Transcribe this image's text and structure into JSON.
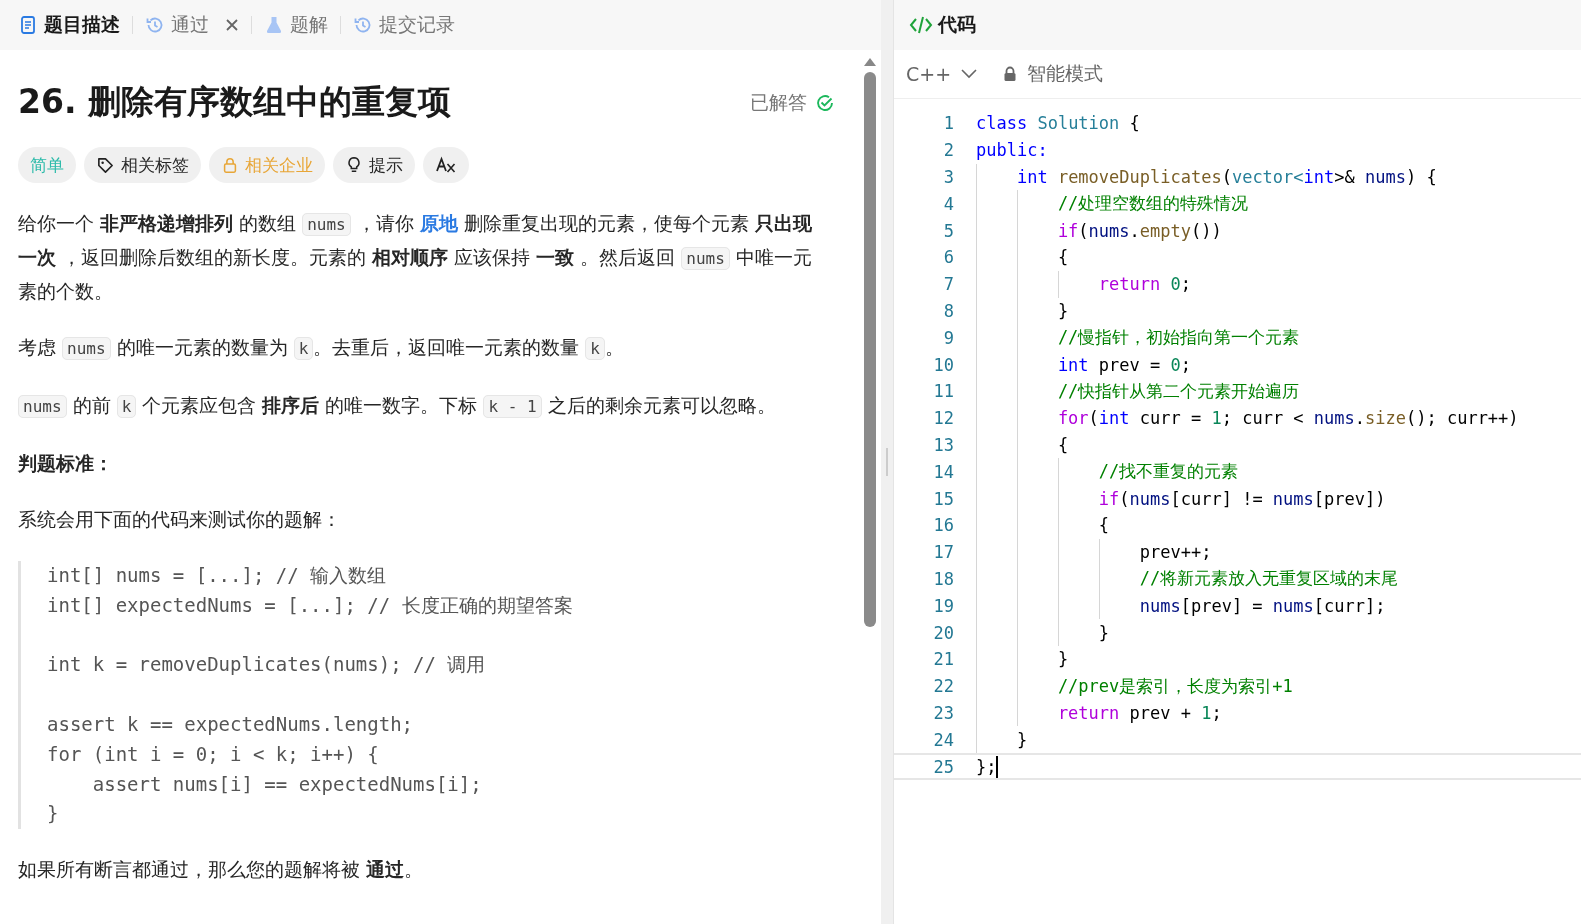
{
  "left_tabs": [
    {
      "label": "题目描述",
      "kind": "doc",
      "selected": true,
      "closable": false
    },
    {
      "label": "通过",
      "kind": "history",
      "selected": false,
      "closable": true
    },
    {
      "label": "题解",
      "kind": "flask",
      "selected": false,
      "closable": false
    },
    {
      "label": "提交记录",
      "kind": "history",
      "selected": false,
      "closable": false
    }
  ],
  "problem": {
    "title": "26. 删除有序数组中的重复项",
    "status": "已解答",
    "chips": [
      {
        "label": "简单",
        "kind": "difficulty"
      },
      {
        "label": "相关标签",
        "kind": "tag"
      },
      {
        "label": "相关企业",
        "kind": "company"
      },
      {
        "label": "提示",
        "kind": "hint"
      },
      {
        "kind": "translate"
      }
    ],
    "paragraphs": [
      [
        {
          "t": "给你一个 ",
          "kind": "text"
        },
        {
          "t": "非严格递增排列",
          "kind": "bold"
        },
        {
          "t": " 的数组 ",
          "kind": "text"
        },
        {
          "t": "nums",
          "kind": "code"
        },
        {
          "t": " ，请你 ",
          "kind": "text"
        },
        {
          "t": "原地",
          "kind": "link"
        },
        {
          "t": " 删除重复出现的元素，使每个元素 ",
          "kind": "text"
        },
        {
          "t": "只出现一次",
          "kind": "bold"
        },
        {
          "t": " ，返回删除后数组的新长度。元素的 ",
          "kind": "text"
        },
        {
          "t": "相对顺序",
          "kind": "bold"
        },
        {
          "t": " 应该保持 ",
          "kind": "text"
        },
        {
          "t": "一致",
          "kind": "bold"
        },
        {
          "t": " 。然后返回 ",
          "kind": "text"
        },
        {
          "t": "nums",
          "kind": "code"
        },
        {
          "t": " 中唯一元素的个数。",
          "kind": "text"
        }
      ],
      [
        {
          "t": "考虑 ",
          "kind": "text"
        },
        {
          "t": "nums",
          "kind": "code"
        },
        {
          "t": " 的唯一元素的数量为 ",
          "kind": "text"
        },
        {
          "t": "k",
          "kind": "code"
        },
        {
          "t": "。去重后，返回唯一元素的数量 ",
          "kind": "text"
        },
        {
          "t": "k",
          "kind": "code"
        },
        {
          "t": "。",
          "kind": "text"
        }
      ],
      [
        {
          "t": "nums",
          "kind": "code"
        },
        {
          "t": " 的前 ",
          "kind": "text"
        },
        {
          "t": "k",
          "kind": "code"
        },
        {
          "t": " 个元素应包含 ",
          "kind": "text"
        },
        {
          "t": "排序后",
          "kind": "bold"
        },
        {
          "t": " 的唯一数字。下标 ",
          "kind": "text"
        },
        {
          "t": "k - 1",
          "kind": "code"
        },
        {
          "t": " 之后的剩余元素可以忽略。",
          "kind": "text"
        }
      ]
    ],
    "judge_heading": "判题标准：",
    "judge_intro": "系统会用下面的代码来测试你的题解：",
    "judge_code": [
      [
        "int[] nums = [...]; // 输入数组",
        "int[] expectedNums = [...]; // 长度正确的期望答案"
      ],
      [
        "int k = removeDuplicates(nums); // 调用"
      ],
      [
        "assert k == expectedNums.length;",
        "for (int i = 0; i < k; i++) {",
        "    assert nums[i] == expectedNums[i];",
        "}"
      ]
    ],
    "closing": [
      {
        "t": "如果所有断言都通过，那么您的题解将被 ",
        "kind": "text"
      },
      {
        "t": "通过",
        "kind": "bold"
      },
      {
        "t": "。",
        "kind": "text"
      }
    ]
  },
  "code_panel": {
    "title": "代码",
    "language": "C++",
    "mode": "智能模式",
    "lines": [
      {
        "num": "1",
        "current": false,
        "tokens": [
          {
            "t": "class",
            "kind": "kw"
          },
          {
            "t": " Solution",
            "kind": "type"
          },
          {
            "t": " {",
            "kind": "plain"
          }
        ]
      },
      {
        "num": "2",
        "current": false,
        "tokens": [
          {
            "t": "public:",
            "kind": "kw"
          }
        ]
      },
      {
        "num": "3",
        "current": false,
        "tokens": [
          {
            "t": "    int",
            "kind": "kw"
          },
          {
            "t": " removeDuplicates",
            "kind": "fn"
          },
          {
            "t": "(",
            "kind": "plain"
          },
          {
            "t": "vector<",
            "kind": "type"
          },
          {
            "t": "int",
            "kind": "kw"
          },
          {
            "t": ">&",
            "kind": "plain"
          },
          {
            "t": " nums",
            "kind": "var"
          },
          {
            "t": ") {",
            "kind": "plain"
          }
        ]
      },
      {
        "num": "4",
        "current": false,
        "tokens": [
          {
            "t": "        //处理空数组的特殊情况",
            "kind": "comment"
          }
        ]
      },
      {
        "num": "5",
        "current": false,
        "tokens": [
          {
            "t": "        if",
            "kind": "ctrl"
          },
          {
            "t": "(",
            "kind": "plain"
          },
          {
            "t": "nums",
            "kind": "var"
          },
          {
            "t": ".",
            "kind": "plain"
          },
          {
            "t": "empty",
            "kind": "fn"
          },
          {
            "t": "())",
            "kind": "plain"
          }
        ]
      },
      {
        "num": "6",
        "current": false,
        "tokens": [
          {
            "t": "        {",
            "kind": "plain"
          }
        ]
      },
      {
        "num": "7",
        "current": false,
        "tokens": [
          {
            "t": "            return",
            "kind": "ctrl"
          },
          {
            "t": " 0",
            "kind": "num"
          },
          {
            "t": ";",
            "kind": "plain"
          }
        ]
      },
      {
        "num": "8",
        "current": false,
        "tokens": [
          {
            "t": "        }",
            "kind": "plain"
          }
        ]
      },
      {
        "num": "9",
        "current": false,
        "tokens": [
          {
            "t": "        //慢指针，初始指向第一个元素",
            "kind": "comment"
          }
        ]
      },
      {
        "num": "10",
        "current": false,
        "tokens": [
          {
            "t": "        int",
            "kind": "kw"
          },
          {
            "t": " prev = ",
            "kind": "plain"
          },
          {
            "t": "0",
            "kind": "num"
          },
          {
            "t": ";",
            "kind": "plain"
          }
        ]
      },
      {
        "num": "11",
        "current": false,
        "tokens": [
          {
            "t": "        //快指针从第二个元素开始遍历",
            "kind": "comment"
          }
        ]
      },
      {
        "num": "12",
        "current": false,
        "tokens": [
          {
            "t": "        for",
            "kind": "ctrl"
          },
          {
            "t": "(",
            "kind": "plain"
          },
          {
            "t": "int",
            "kind": "kw"
          },
          {
            "t": " curr = ",
            "kind": "plain"
          },
          {
            "t": "1",
            "kind": "num"
          },
          {
            "t": "; curr < ",
            "kind": "plain"
          },
          {
            "t": "nums",
            "kind": "var"
          },
          {
            "t": ".",
            "kind": "plain"
          },
          {
            "t": "size",
            "kind": "fn"
          },
          {
            "t": "(); curr++)",
            "kind": "plain"
          }
        ]
      },
      {
        "num": "13",
        "current": false,
        "tokens": [
          {
            "t": "        {",
            "kind": "plain"
          }
        ]
      },
      {
        "num": "14",
        "current": false,
        "tokens": [
          {
            "t": "            //找不重复的元素",
            "kind": "comment"
          }
        ]
      },
      {
        "num": "15",
        "current": false,
        "tokens": [
          {
            "t": "            if",
            "kind": "ctrl"
          },
          {
            "t": "(",
            "kind": "plain"
          },
          {
            "t": "nums",
            "kind": "var"
          },
          {
            "t": "[curr] != ",
            "kind": "plain"
          },
          {
            "t": "nums",
            "kind": "var"
          },
          {
            "t": "[prev])",
            "kind": "plain"
          }
        ]
      },
      {
        "num": "16",
        "current": false,
        "tokens": [
          {
            "t": "            {",
            "kind": "plain"
          }
        ]
      },
      {
        "num": "17",
        "current": false,
        "tokens": [
          {
            "t": "                prev++;",
            "kind": "plain"
          }
        ]
      },
      {
        "num": "18",
        "current": false,
        "tokens": [
          {
            "t": "                //将新元素放入无重复区域的末尾",
            "kind": "comment"
          }
        ]
      },
      {
        "num": "19",
        "current": false,
        "tokens": [
          {
            "t": "                nums",
            "kind": "var"
          },
          {
            "t": "[prev] = ",
            "kind": "plain"
          },
          {
            "t": "nums",
            "kind": "var"
          },
          {
            "t": "[curr];",
            "kind": "plain"
          }
        ]
      },
      {
        "num": "20",
        "current": false,
        "tokens": [
          {
            "t": "            }",
            "kind": "plain"
          }
        ]
      },
      {
        "num": "21",
        "current": false,
        "tokens": [
          {
            "t": "        }",
            "kind": "plain"
          }
        ]
      },
      {
        "num": "22",
        "current": false,
        "tokens": [
          {
            "t": "        //prev是索引，长度为索引+1",
            "kind": "comment"
          }
        ]
      },
      {
        "num": "23",
        "current": false,
        "tokens": [
          {
            "t": "        return",
            "kind": "ctrl"
          },
          {
            "t": " prev + ",
            "kind": "plain"
          },
          {
            "t": "1",
            "kind": "num"
          },
          {
            "t": ";",
            "kind": "plain"
          }
        ]
      },
      {
        "num": "24",
        "current": false,
        "tokens": [
          {
            "t": "    }",
            "kind": "plain"
          }
        ]
      },
      {
        "num": "25",
        "current": true,
        "tokens": [
          {
            "t": "};",
            "kind": "plain"
          }
        ]
      }
    ]
  }
}
